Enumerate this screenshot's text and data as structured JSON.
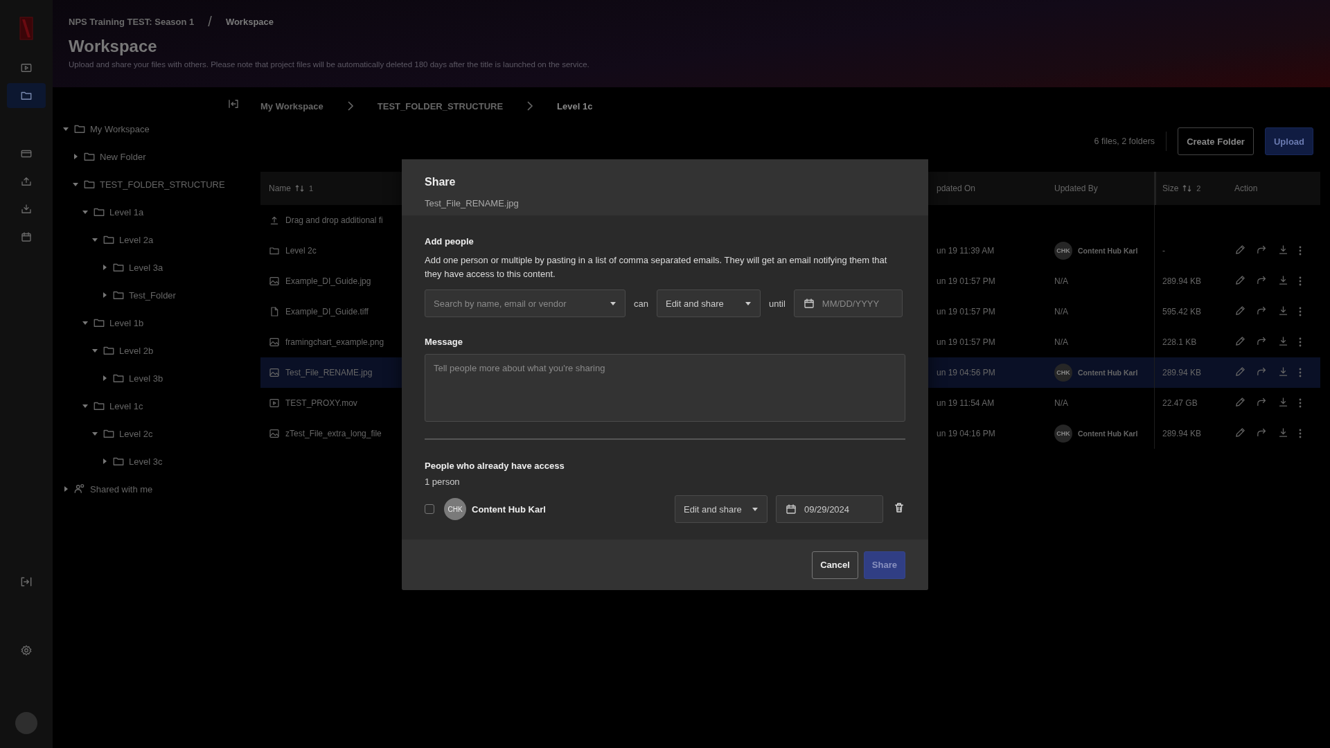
{
  "rail": {
    "items": [
      {
        "kind": "media",
        "selected": false
      },
      {
        "kind": "folder",
        "selected": true
      },
      {
        "kind": "card",
        "selected": false
      },
      {
        "kind": "tray-up",
        "selected": false
      },
      {
        "kind": "tray-down",
        "selected": false
      },
      {
        "kind": "calendar",
        "selected": false
      }
    ]
  },
  "header": {
    "breadcrumb": [
      "NPS Training TEST: Season 1",
      "Workspace"
    ],
    "separator": "/",
    "title": "Workspace",
    "description": "Upload and share your files with others. Please note that project files will be automatically deleted 180 days after the title is launched on the service."
  },
  "tree": [
    {
      "kind": "folder",
      "label": "My Workspace",
      "expanded": true,
      "children": [
        {
          "kind": "folder",
          "label": "New Folder",
          "expanded": false
        },
        {
          "kind": "folder",
          "label": "TEST_FOLDER_STRUCTURE",
          "expanded": true,
          "children": [
            {
              "kind": "folder",
              "label": "Level 1a",
              "expanded": true,
              "children": [
                {
                  "kind": "folder",
                  "label": "Level 2a",
                  "expanded": true,
                  "children": [
                    {
                      "kind": "folder",
                      "label": "Level 3a",
                      "expanded": false
                    },
                    {
                      "kind": "folder",
                      "label": "Test_Folder",
                      "expanded": false
                    }
                  ]
                }
              ]
            },
            {
              "kind": "folder",
              "label": "Level 1b",
              "expanded": true,
              "children": [
                {
                  "kind": "folder",
                  "label": "Level 2b",
                  "expanded": true,
                  "children": [
                    {
                      "kind": "folder",
                      "label": "Level 3b",
                      "expanded": false
                    }
                  ]
                }
              ]
            },
            {
              "kind": "folder",
              "label": "Level 1c",
              "expanded": true,
              "children": [
                {
                  "kind": "folder",
                  "label": "Level 2c",
                  "expanded": true,
                  "children": [
                    {
                      "kind": "folder",
                      "label": "Level 3c",
                      "expanded": false
                    }
                  ]
                }
              ]
            }
          ]
        }
      ]
    },
    {
      "kind": "shared",
      "label": "Shared with me",
      "expanded": false
    }
  ],
  "path": [
    "My Workspace",
    "TEST_FOLDER_STRUCTURE",
    "Level 1c"
  ],
  "summary": "6 files, 2 folders",
  "toolbar_buttons": [
    {
      "label": "Create Folder",
      "kind": "secondary"
    },
    {
      "label": "Upload",
      "kind": "primary"
    }
  ],
  "table": {
    "columns": [
      {
        "label": "Name",
        "sort": "1"
      },
      {
        "label": "pdated On"
      },
      {
        "label": "Updated By"
      },
      {
        "label": "Size",
        "sort": "2"
      },
      {
        "label": "Action"
      }
    ],
    "rows": [
      {
        "kind": "upload",
        "name": "Drag and drop additional fi",
        "selected": false
      },
      {
        "kind": "folder",
        "name": "Level 2c",
        "updated_on": "un 19 11:39 AM",
        "updated_by": "Content Hub Karl",
        "initials": "CHK",
        "size": "-",
        "selected": false
      },
      {
        "kind": "image",
        "name": "Example_DI_Guide.jpg",
        "updated_on": "un 19 01:57 PM",
        "updated_by": "N/A",
        "size": "289.94 KB",
        "selected": false
      },
      {
        "kind": "file",
        "name": "Example_DI_Guide.tiff",
        "updated_on": "un 19 01:57 PM",
        "updated_by": "N/A",
        "size": "595.42 KB",
        "selected": false
      },
      {
        "kind": "image",
        "name": "framingchart_example.png",
        "updated_on": "un 19 01:57 PM",
        "updated_by": "N/A",
        "size": "228.1 KB",
        "selected": false
      },
      {
        "kind": "image",
        "name": "Test_File_RENAME.jpg",
        "updated_on": "un 19 04:56 PM",
        "updated_by": "Content Hub Karl",
        "initials": "CHK",
        "size": "289.94 KB",
        "selected": true
      },
      {
        "kind": "video",
        "name": "TEST_PROXY.mov",
        "updated_on": "un 19 11:54 AM",
        "updated_by": "N/A",
        "size": "22.47 GB",
        "selected": false
      },
      {
        "kind": "image",
        "name": "zTest_File_extra_long_file",
        "updated_on": "un 19 04:16 PM",
        "updated_by": "Content Hub Karl",
        "initials": "CHK",
        "size": "289.94 KB",
        "selected": false
      }
    ]
  },
  "dialog": {
    "title": "Share",
    "subtitle": "Test_File_RENAME.jpg",
    "add_heading": "Add people",
    "add_description": "Add one person or multiple by pasting in a list of comma separated emails. They will get an email notifying them that they have access to this content.",
    "search": {
      "placeholder": "Search by name, email or vendor"
    },
    "can_label": "can",
    "permission": "Edit and share",
    "until_label": "until",
    "date": {
      "placeholder": "MM/DD/YYYY"
    },
    "message_label": "Message",
    "message": {
      "placeholder": "Tell people more about what you're sharing"
    },
    "access_heading": "People who already have access",
    "access_count": "1 person",
    "people": [
      {
        "initials": "CHK",
        "name": "Content Hub Karl",
        "checked": false,
        "permission": "Edit and share",
        "date": "09/29/2024"
      }
    ],
    "buttons": [
      {
        "label": "Cancel",
        "kind": "secondary",
        "disabled": false
      },
      {
        "label": "Share",
        "kind": "primary",
        "disabled": true
      }
    ]
  }
}
